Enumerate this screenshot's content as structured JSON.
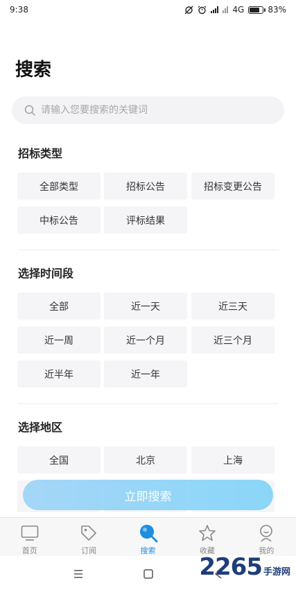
{
  "status_bar": {
    "time": "9:38",
    "network": "4G",
    "battery": "83%",
    "battery_level": 0.83
  },
  "page": {
    "title": "搜索"
  },
  "search": {
    "placeholder": "请输入您要搜索的关键词"
  },
  "sections": {
    "bid_type": {
      "title": "招标类型",
      "options": [
        "全部类型",
        "招标公告",
        "招标变更公告",
        "中标公告",
        "评标结果"
      ]
    },
    "time_range": {
      "title": "选择时间段",
      "options": [
        "全部",
        "近一天",
        "近三天",
        "近一周",
        "近一个月",
        "近三个月",
        "近半年",
        "近一年"
      ]
    },
    "region": {
      "title": "选择地区",
      "options": [
        "全国",
        "北京",
        "上海"
      ]
    }
  },
  "actions": {
    "search_now": "立即搜索"
  },
  "tabs": [
    {
      "label": "首页",
      "icon": "tv-icon",
      "active": false
    },
    {
      "label": "订阅",
      "icon": "tag-icon",
      "active": false
    },
    {
      "label": "搜索",
      "icon": "search-icon",
      "active": true
    },
    {
      "label": "收藏",
      "icon": "star-icon",
      "active": false
    },
    {
      "label": "我的",
      "icon": "user-icon",
      "active": false
    }
  ],
  "watermark": {
    "number": "2265",
    "text": "手游网"
  },
  "colors": {
    "accent": "#1e8fe0",
    "button_gradient_start": "#9cd2f7",
    "button_gradient_end": "#7fd3f8",
    "chip_bg": "#f5f5f7"
  }
}
